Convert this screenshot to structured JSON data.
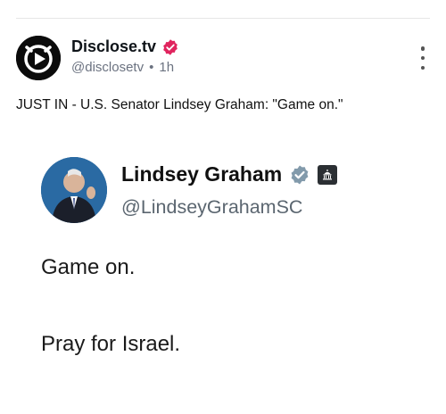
{
  "post": {
    "author_name": "Disclose.tv",
    "handle": "@disclosetv",
    "time": "1h",
    "separator": "•",
    "text": "JUST IN - U.S. Senator Lindsey Graham: \"Game on.\""
  },
  "embed": {
    "name": "Lindsey Graham",
    "handle": "@LindseyGrahamSC",
    "line1": "Game on.",
    "line2": "Pray for Israel."
  },
  "icons": {
    "verified_post": "verified-badge-icon",
    "verified_embed": "verified-badge-icon",
    "government_badge": "capitol-building-icon",
    "more": "more-vertical-icon"
  },
  "colors": {
    "verified_red": "#e0245e",
    "verified_gray": "#829aab",
    "text_dark": "#0f1419",
    "text_muted": "#6b7280"
  }
}
